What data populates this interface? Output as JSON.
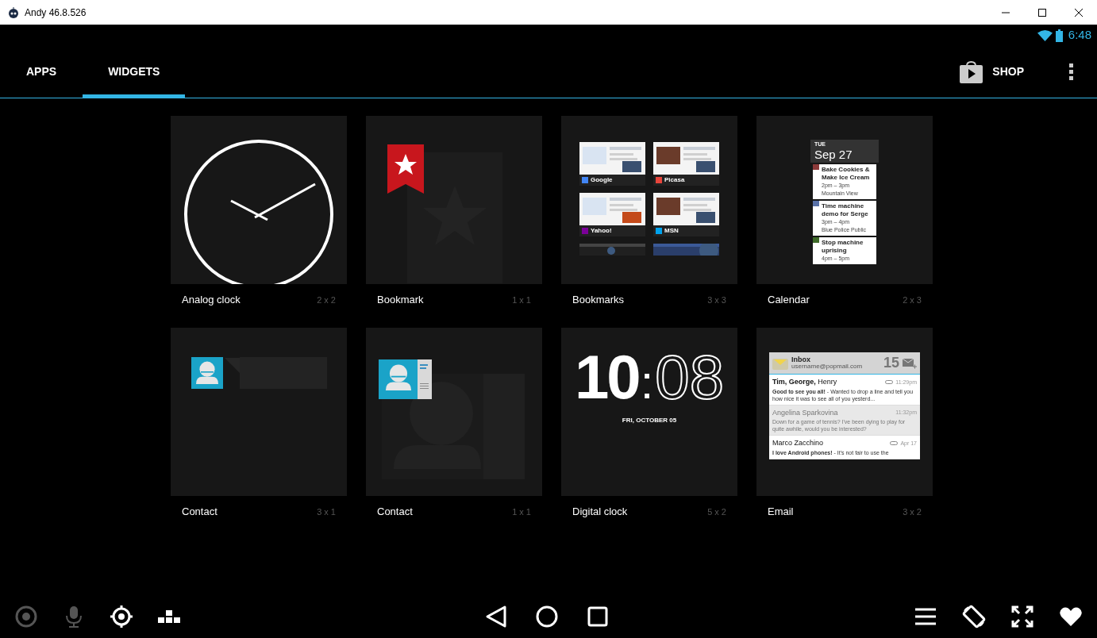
{
  "window": {
    "title": "Andy 46.8.526"
  },
  "status_bar": {
    "time": "6:48"
  },
  "tabs": [
    {
      "label": "APPS",
      "selected": false
    },
    {
      "label": "WIDGETS",
      "selected": true
    }
  ],
  "shop": {
    "label": "SHOP"
  },
  "widgets": [
    {
      "name": "Analog clock",
      "size": "2 x 2",
      "preview": {
        "kind": "analog_clock"
      }
    },
    {
      "name": "Bookmark",
      "size": "1 x 1",
      "preview": {
        "kind": "bookmark"
      }
    },
    {
      "name": "Bookmarks",
      "size": "3 x 3",
      "preview": {
        "kind": "bookmarks",
        "sites": [
          {
            "label": "Google",
            "color": "#4285f4"
          },
          {
            "label": "Picasa",
            "color": "#e8453c"
          },
          {
            "label": "Yahoo!",
            "color": "#7b0099"
          },
          {
            "label": "MSN",
            "color": "#00a2ed"
          }
        ]
      }
    },
    {
      "name": "Calendar",
      "size": "2 x 3",
      "preview": {
        "kind": "calendar",
        "day": "TUE",
        "date": "Sep 27",
        "events": [
          {
            "title": "Bake Cookies & Make Ice Cream",
            "time": "2pm – 3pm",
            "place": "Mountain View",
            "color": "#8c3a3a"
          },
          {
            "title": "Time machine demo for Serge",
            "time": "3pm – 4pm",
            "place": "Blue Police Public",
            "color": "#5a72a8"
          },
          {
            "title": "Stop machine uprising",
            "time": "4pm – 5pm",
            "color": "#3f6b2a"
          }
        ]
      }
    },
    {
      "name": "Contact",
      "size": "3 x 1",
      "preview": {
        "kind": "contact_wide"
      }
    },
    {
      "name": "Contact",
      "size": "1 x 1",
      "preview": {
        "kind": "contact_card"
      }
    },
    {
      "name": "Digital clock",
      "size": "5 x 2",
      "preview": {
        "kind": "digital_clock",
        "hours": "10",
        "separator": ":",
        "minutes": "08",
        "date": "FRI, OCTOBER 05"
      }
    },
    {
      "name": "Email",
      "size": "3 x 2",
      "preview": {
        "kind": "email",
        "folder": "Inbox",
        "account": "username@popmail.com",
        "count": "15",
        "messages": [
          {
            "sender": "**Tim, George,** Henry",
            "time": "11:29pm",
            "snippet": "**Good to see you all!** - Wanted to drop a line and tell you how nice it was to see all of you yesterd...",
            "unread": true
          },
          {
            "sender": "Angelina Sparkovina",
            "time": "11:32pm",
            "snippet": "Down for a game of tennis? I've been dying to play for quite awhile, would you be interested?",
            "unread": false
          },
          {
            "sender": "Marco Zacchino",
            "time": "Apr 17",
            "snippet": "**I love Android phones!** -  It's not fair to use the",
            "unread": true
          }
        ]
      }
    }
  ],
  "bottom_bar": {
    "left": [
      {
        "kind": "camera",
        "disabled": true
      },
      {
        "kind": "microphone",
        "disabled": true
      },
      {
        "kind": "location",
        "disabled": false
      },
      {
        "kind": "dpad",
        "disabled": false
      }
    ],
    "center": [
      {
        "kind": "back"
      },
      {
        "kind": "home"
      },
      {
        "kind": "recents"
      }
    ],
    "right": [
      {
        "kind": "menu"
      },
      {
        "kind": "rotate"
      },
      {
        "kind": "fullscreen"
      },
      {
        "kind": "favorite"
      }
    ]
  }
}
